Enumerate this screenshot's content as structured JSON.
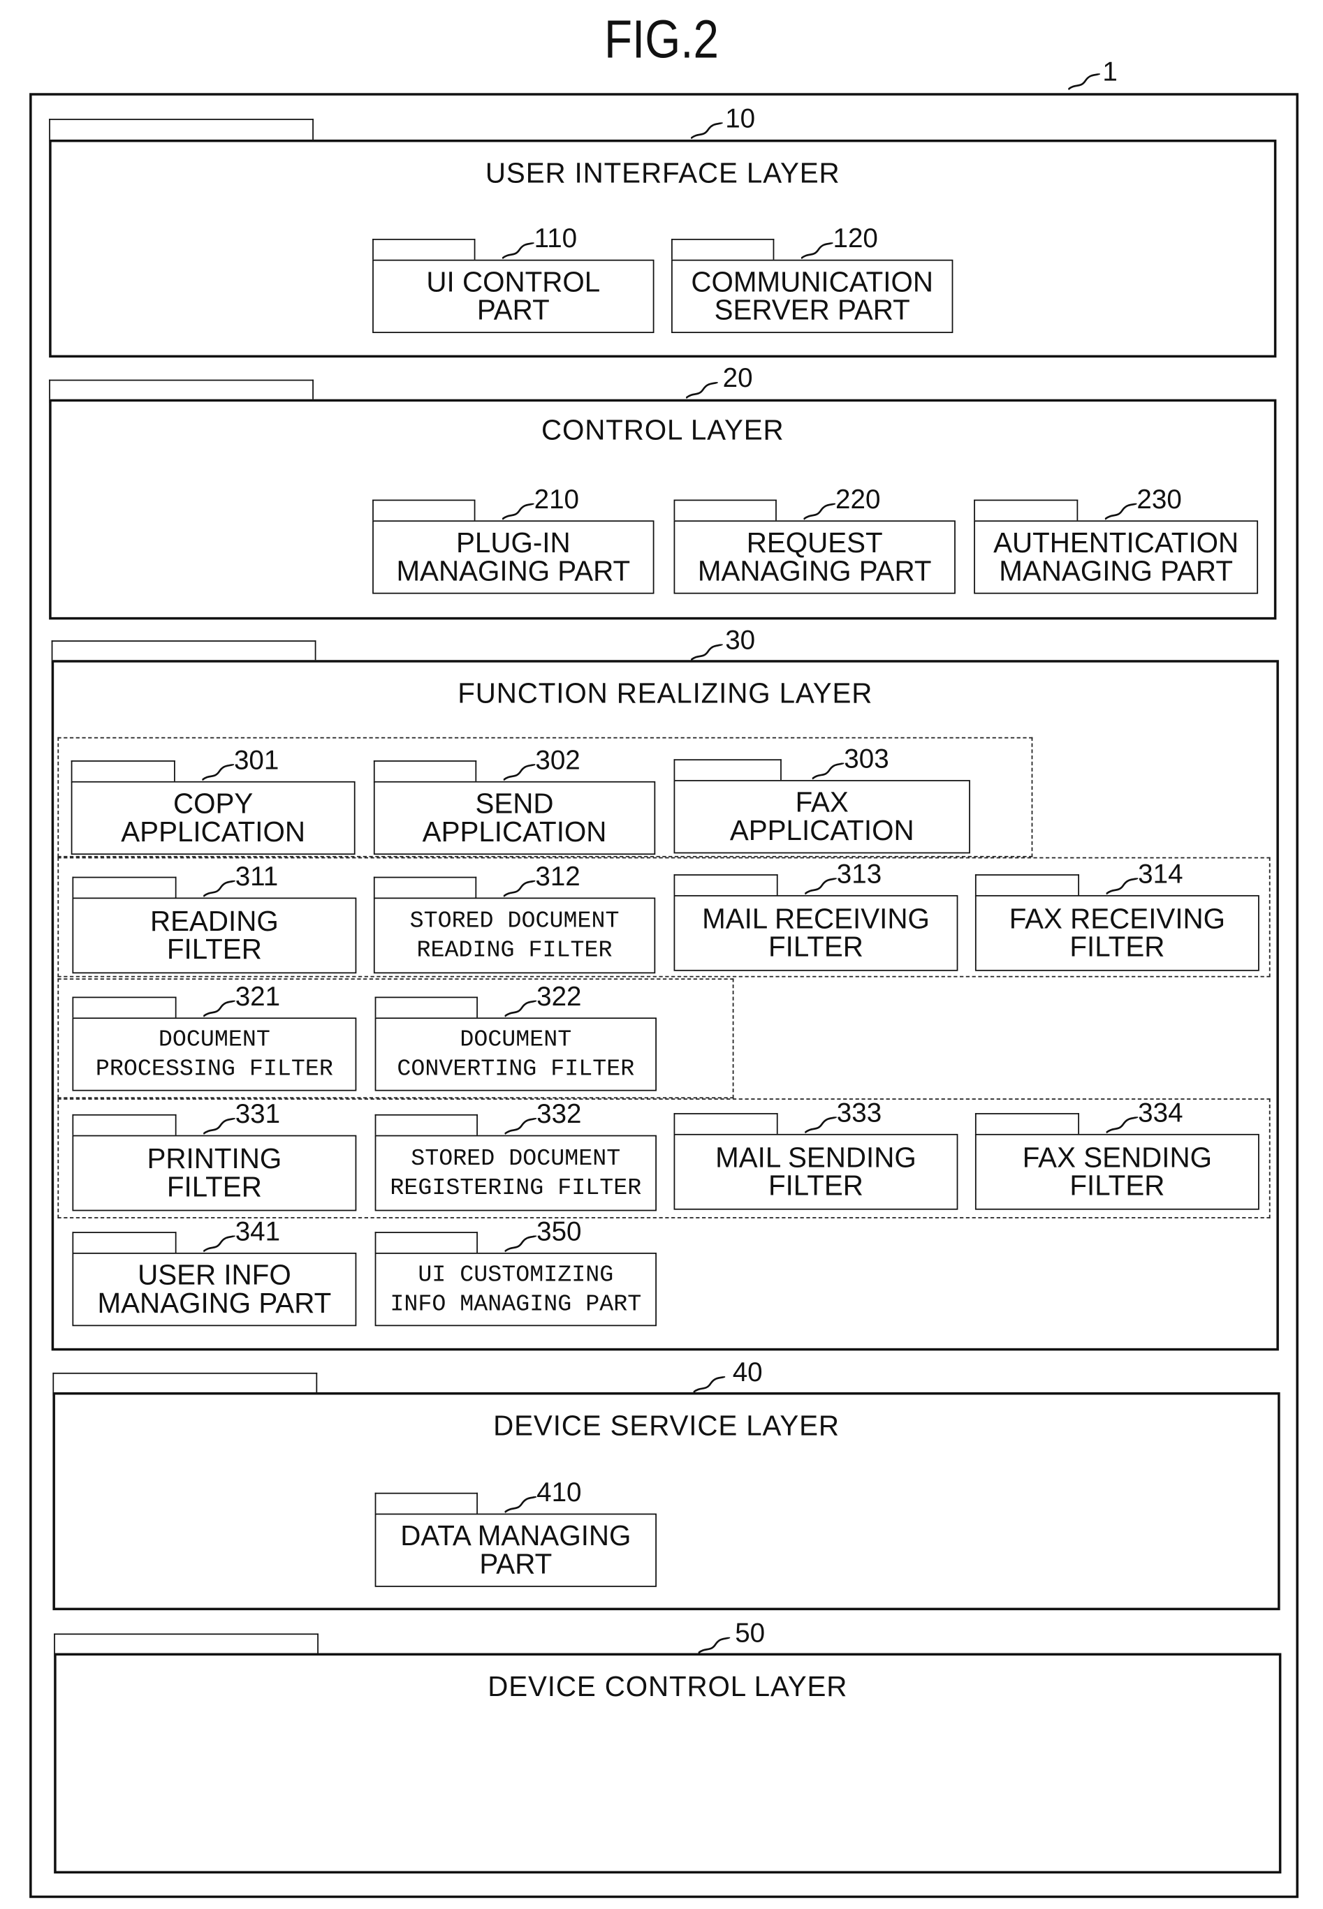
{
  "figure": {
    "title": "FIG.2",
    "system_ref": "1"
  },
  "layers": [
    {
      "ref": "10",
      "title": "USER INTERFACE LAYER"
    },
    {
      "ref": "20",
      "title": "CONTROL LAYER"
    },
    {
      "ref": "30",
      "title": "FUNCTION REALIZING LAYER"
    },
    {
      "ref": "40",
      "title": "DEVICE SERVICE LAYER"
    },
    {
      "ref": "50",
      "title": "DEVICE CONTROL LAYER"
    }
  ],
  "components": {
    "c110": {
      "ref": "110",
      "line1": "UI CONTROL",
      "line2": "PART"
    },
    "c120": {
      "ref": "120",
      "line1": "COMMUNICATION",
      "line2": "SERVER PART"
    },
    "c210": {
      "ref": "210",
      "line1": "PLUG-IN",
      "line2": "MANAGING PART"
    },
    "c220": {
      "ref": "220",
      "line1": "REQUEST",
      "line2": "MANAGING PART"
    },
    "c230": {
      "ref": "230",
      "line1": "AUTHENTICATION",
      "line2": "MANAGING PART"
    },
    "c301": {
      "ref": "301",
      "line1": "COPY",
      "line2": "APPLICATION"
    },
    "c302": {
      "ref": "302",
      "line1": "SEND",
      "line2": "APPLICATION"
    },
    "c303": {
      "ref": "303",
      "line1": "FAX",
      "line2": "APPLICATION"
    },
    "c311": {
      "ref": "311",
      "line1": "READING",
      "line2": "FILTER"
    },
    "c312": {
      "ref": "312",
      "line1": "STORED DOCUMENT",
      "line2": "READING FILTER"
    },
    "c313": {
      "ref": "313",
      "line1": "MAIL RECEIVING",
      "line2": "FILTER"
    },
    "c314": {
      "ref": "314",
      "line1": "FAX RECEIVING",
      "line2": "FILTER"
    },
    "c321": {
      "ref": "321",
      "line1": "DOCUMENT",
      "line2": "PROCESSING FILTER"
    },
    "c322": {
      "ref": "322",
      "line1": "DOCUMENT",
      "line2": "CONVERTING FILTER"
    },
    "c331": {
      "ref": "331",
      "line1": "PRINTING",
      "line2": "FILTER"
    },
    "c332": {
      "ref": "332",
      "line1": "STORED DOCUMENT",
      "line2": "REGISTERING FILTER"
    },
    "c333": {
      "ref": "333",
      "line1": "MAIL SENDING",
      "line2": "FILTER"
    },
    "c334": {
      "ref": "334",
      "line1": "FAX SENDING",
      "line2": "FILTER"
    },
    "c341": {
      "ref": "341",
      "line1": "USER INFO",
      "line2": "MANAGING PART"
    },
    "c350": {
      "ref": "350",
      "line1": "UI CUSTOMIZING",
      "line2": "INFO MANAGING PART"
    },
    "c410": {
      "ref": "410",
      "line1": "DATA MANAGING",
      "line2": "PART"
    }
  }
}
